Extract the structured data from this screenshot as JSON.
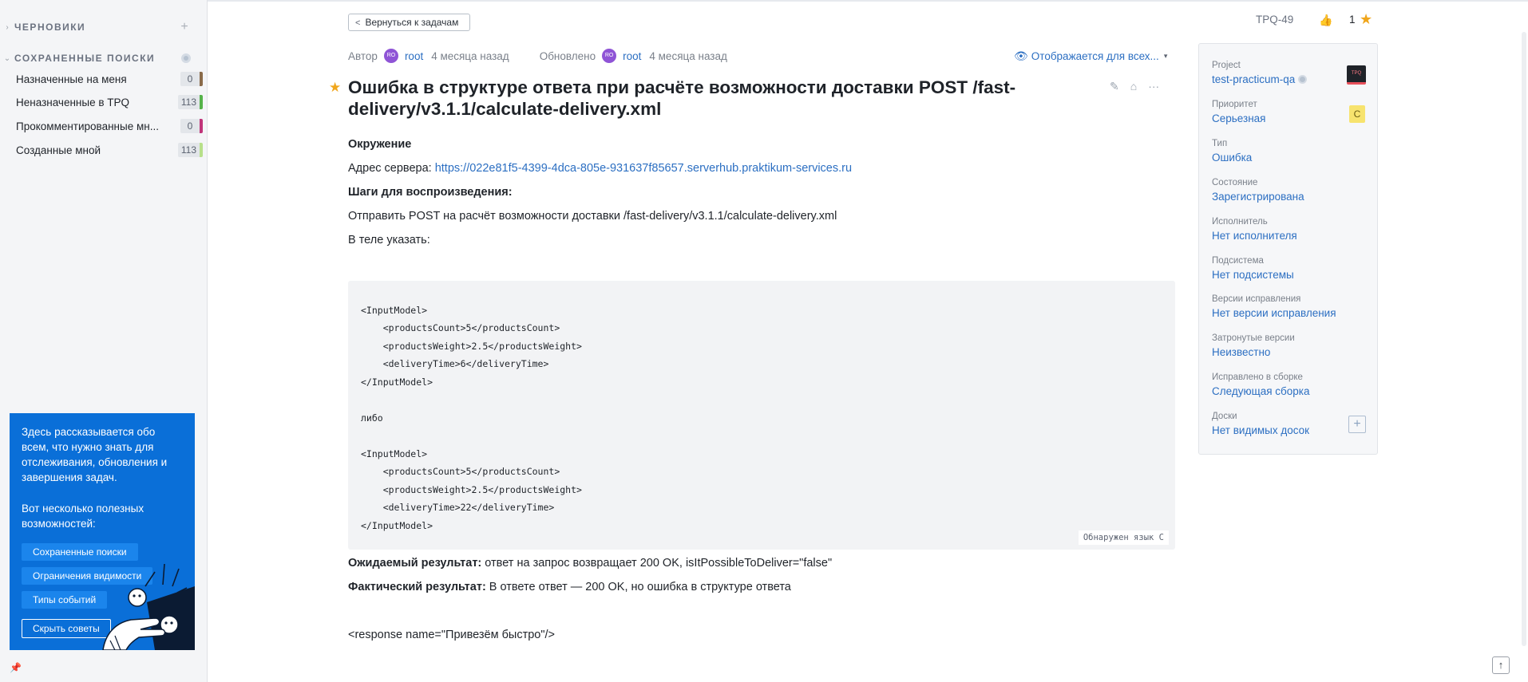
{
  "sidebar": {
    "drafts_title": "ЧЕРНОВИКИ",
    "drafts_add": "+",
    "saved_title": "СОХРАНЕННЫЕ ПОИСКИ",
    "saved_searches": [
      {
        "label": "Назначенные на меня",
        "count": "0",
        "color": "#8a6b4a"
      },
      {
        "label": "Неназначенные в TPQ",
        "count": "113",
        "color": "#56b34a"
      },
      {
        "label": "Прокомментированные мн...",
        "count": "0",
        "color": "#c0357a"
      },
      {
        "label": "Созданные мной",
        "count": "113",
        "color": "#b8e08a"
      }
    ],
    "tips": {
      "text1": "Здесь рассказывается обо всем, что нужно знать для отслеживания, обновления и завершения задач.",
      "text2": "Вот несколько полезных возможностей:",
      "buttons": [
        "Сохраненные поиски",
        "Ограничения видимости",
        "Типы событий"
      ],
      "hide_label": "Скрыть советы"
    }
  },
  "header": {
    "back_label": "Вернуться к задачам",
    "issue_id": "TPQ-49",
    "votes": "1"
  },
  "meta": {
    "author_label": "Автор",
    "author_avatar": "RO",
    "author": "root",
    "author_time": "4 месяца назад",
    "updated_label": "Обновлено",
    "updater_avatar": "RO",
    "updater": "root",
    "updated_time": "4 месяца назад",
    "visibility": "Отображается для всех..."
  },
  "issue": {
    "title": "Ошибка в структуре ответа при расчёте возможности доставки POST /fast-delivery/v3.1.1/calculate-delivery.xml",
    "env_heading": "Окружение",
    "server_label": "Адрес сервера: ",
    "server_url": "https://022e81f5-4399-4dca-805e-931637f85657.serverhub.praktikum-services.ru",
    "steps_heading": "Шаги для воспроизведения:",
    "step1": "Отправить POST на расчёт возможности доставки /fast-delivery/v3.1.1/calculate-delivery.xml",
    "step2": "В теле указать:",
    "code_lines": [
      "<InputModel>",
      "    <productsCount>5</productsCount>",
      "    <productsWeight>2.5</productsWeight>",
      "    <deliveryTime>6</deliveryTime>",
      "</InputModel>",
      "",
      "либо",
      "",
      "<InputModel>",
      "    <productsCount>5</productsCount>",
      "    <productsWeight>2.5</productsWeight>",
      "    <deliveryTime>22</deliveryTime>",
      "</InputModel>"
    ],
    "code_lang": "Обнаружен язык C",
    "expected_label": "Ожидаемый результат:",
    "expected_text": " ответ на запрос возвращает 200 OK, isItPossibleToDeliver=\"false\"",
    "actual_label": "Фактический результат:",
    "actual_text": " В ответе ответ — 200 OK, но ошибка в структуре ответа",
    "response_line": "<response name=\"Привезём быстро\"/>"
  },
  "fields": [
    {
      "label": "Project",
      "value": "test-practicum-qa"
    },
    {
      "label": "Приоритет",
      "value": "Серьезная",
      "badge": "C"
    },
    {
      "label": "Тип",
      "value": "Ошибка"
    },
    {
      "label": "Состояние",
      "value": "Зарегистрирована"
    },
    {
      "label": "Исполнитель",
      "value": "Нет исполнителя"
    },
    {
      "label": "Подсистема",
      "value": "Нет подсистемы"
    },
    {
      "label": "Версии исправления",
      "value": "Нет версии исправления"
    },
    {
      "label": "Затронутые версии",
      "value": "Неизвестно"
    },
    {
      "label": "Исправлено в сборке",
      "value": "Следующая сборка"
    },
    {
      "label": "Доски",
      "value": "Нет видимых досок"
    }
  ],
  "project_logo_text": "TPQ",
  "colors": {
    "accent": "#2c6fc2",
    "tips_bg": "#0a6fd8",
    "star": "#f0a61c",
    "avatar": "#8f54d6"
  }
}
